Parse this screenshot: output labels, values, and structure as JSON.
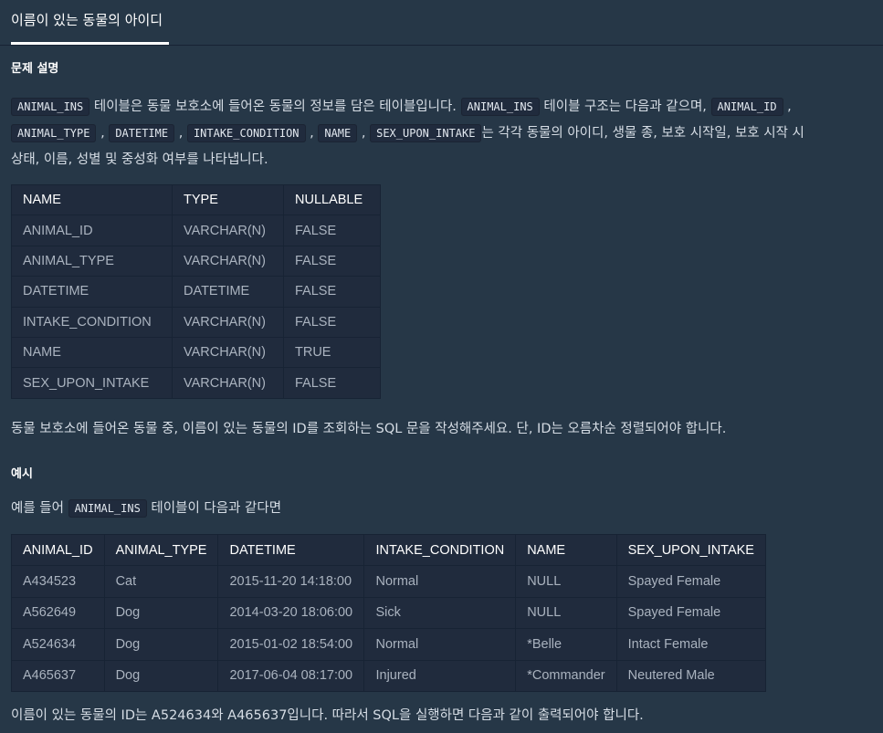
{
  "tab": {
    "label": "이름이 있는 동물의 아이디"
  },
  "section_problem": {
    "title": "문제 설명"
  },
  "intro": {
    "code_table": "ANIMAL_INS",
    "text1": " 테이블은 동물 보호소에 들어온 동물의 정보를 담은 테이블입니다. ",
    "code_table2": "ANIMAL_INS",
    "text2": " 테이블 구조는 다음과 같으며, ",
    "col1": "ANIMAL_ID",
    "sep": " , ",
    "col2": "ANIMAL_TYPE",
    "col3": "DATETIME",
    "col4": "INTAKE_CONDITION",
    "col5": "NAME",
    "col6": "SEX_UPON_INTAKE",
    "text3": "는 각각 동물의 아이디, 생물 종, 보호 시작일, 보호 시작 시",
    "text4": "상태, 이름, 성별 및 중성화 여부를 나타냅니다."
  },
  "schema_table": {
    "headers": [
      "NAME",
      "TYPE",
      "NULLABLE"
    ],
    "rows": [
      [
        "ANIMAL_ID",
        "VARCHAR(N)",
        "FALSE"
      ],
      [
        "ANIMAL_TYPE",
        "VARCHAR(N)",
        "FALSE"
      ],
      [
        "DATETIME",
        "DATETIME",
        "FALSE"
      ],
      [
        "INTAKE_CONDITION",
        "VARCHAR(N)",
        "FALSE"
      ],
      [
        "NAME",
        "VARCHAR(N)",
        "TRUE"
      ],
      [
        "SEX_UPON_INTAKE",
        "VARCHAR(N)",
        "FALSE"
      ]
    ]
  },
  "task": {
    "text": "동물 보호소에 들어온 동물 중, 이름이 있는 동물의 ID를 조회하는 SQL 문을 작성해주세요. 단, ID는 오름차순 정렬되어야 합니다."
  },
  "section_example": {
    "title": "예시"
  },
  "example_intro": {
    "text1": "예를 들어 ",
    "code": "ANIMAL_INS",
    "text2": " 테이블이 다음과 같다면"
  },
  "example_table": {
    "headers": [
      "ANIMAL_ID",
      "ANIMAL_TYPE",
      "DATETIME",
      "INTAKE_CONDITION",
      "NAME",
      "SEX_UPON_INTAKE"
    ],
    "rows": [
      [
        "A434523",
        "Cat",
        "2015-11-20 14:18:00",
        "Normal",
        "NULL",
        "Spayed Female"
      ],
      [
        "A562649",
        "Dog",
        "2014-03-20 18:06:00",
        "Sick",
        "NULL",
        "Spayed Female"
      ],
      [
        "A524634",
        "Dog",
        "2015-01-02 18:54:00",
        "Normal",
        "*Belle",
        "Intact Female"
      ],
      [
        "A465637",
        "Dog",
        "2017-06-04 08:17:00",
        "Injured",
        "*Commander",
        "Neutered Male"
      ]
    ]
  },
  "conclusion": {
    "text": "이름이 있는 동물의 ID는 A524634와 A465637입니다. 따라서 SQL을 실행하면 다음과 같이 출력되어야 합니다."
  }
}
